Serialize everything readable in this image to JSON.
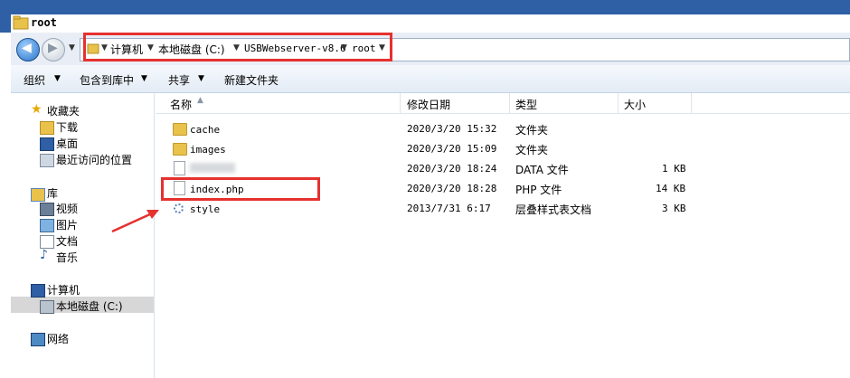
{
  "window": {
    "title": "root"
  },
  "breadcrumb": [
    "计算机",
    "本地磁盘 (C:)",
    "USBWebserver-v8.6",
    "root"
  ],
  "toolbar": {
    "organize": "组织",
    "include": "包含到库中",
    "share": "共享",
    "new_folder": "新建文件夹"
  },
  "nav": {
    "favorites": "收藏夹",
    "downloads": "下载",
    "desktop": "桌面",
    "recent": "最近访问的位置",
    "libraries": "库",
    "videos": "视频",
    "pictures": "图片",
    "documents": "文档",
    "music": "音乐",
    "computer": "计算机",
    "local_disk": "本地磁盘 (C:)",
    "network": "网络"
  },
  "columns": {
    "name": "名称",
    "date": "修改日期",
    "type": "类型",
    "size": "大小"
  },
  "files": [
    {
      "name": "cache",
      "date": "2020/3/20 15:32",
      "type": "文件夹",
      "size": ""
    },
    {
      "name": "images",
      "date": "2020/3/20 15:09",
      "type": "文件夹",
      "size": ""
    },
    {
      "name": "",
      "date": "2020/3/20 18:24",
      "type": "DATA 文件",
      "size": "1 KB"
    },
    {
      "name": "index.php",
      "date": "2020/3/20 18:28",
      "type": "PHP 文件",
      "size": "14 KB"
    },
    {
      "name": "style",
      "date": "2013/7/31 6:17",
      "type": "层叠样式表文档",
      "size": "3 KB"
    }
  ],
  "colors": {
    "annotation": "#e5312f",
    "title_bar": "#2f5fa4",
    "folder": "#e9c24b"
  }
}
